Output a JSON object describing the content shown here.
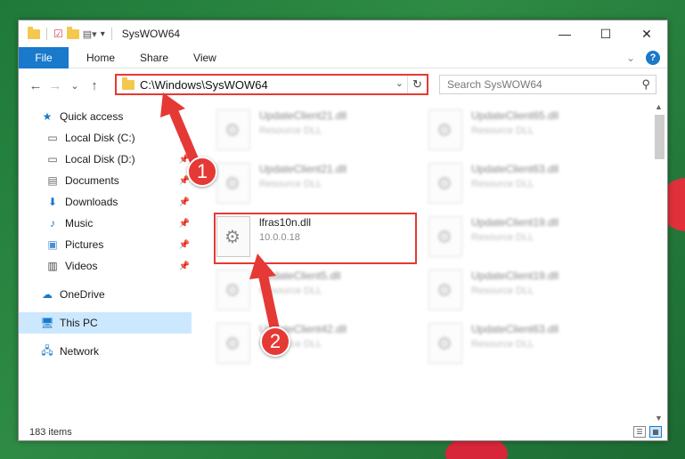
{
  "window": {
    "title": "SysWOW64"
  },
  "ribbon": {
    "file_label": "File",
    "tabs": [
      "Home",
      "Share",
      "View"
    ]
  },
  "navigation": {
    "back_label": "←",
    "forward_label": "→",
    "recent_label": "⌄",
    "up_label": "↑"
  },
  "address": {
    "path": "C:\\Windows\\SysWOW64"
  },
  "search": {
    "placeholder": "Search SysWOW64"
  },
  "sidebar": {
    "items": [
      {
        "label": "Quick access",
        "icon": "star-icon"
      },
      {
        "label": "Local Disk (C:)",
        "icon": "drive-icon"
      },
      {
        "label": "Local Disk (D:)",
        "icon": "drive-icon"
      },
      {
        "label": "Documents",
        "icon": "documents-icon"
      },
      {
        "label": "Downloads",
        "icon": "downloads-icon"
      },
      {
        "label": "Music",
        "icon": "music-icon"
      },
      {
        "label": "Pictures",
        "icon": "pictures-icon"
      },
      {
        "label": "Videos",
        "icon": "videos-icon"
      },
      {
        "label": "OneDrive",
        "icon": "cloud-icon"
      },
      {
        "label": "This PC",
        "icon": "computer-icon"
      },
      {
        "label": "Network",
        "icon": "network-icon"
      }
    ]
  },
  "files": {
    "left": [
      {
        "name": "UpdateClient21.dll",
        "sub": "Resource DLL"
      },
      {
        "name": "UpdateClient21.dll",
        "sub": "Resource DLL"
      },
      {
        "name": "lfras10n.dll",
        "sub": "10.0.0.18"
      },
      {
        "name": "UpdateClient5.dll",
        "sub": "Resource DLL"
      },
      {
        "name": "UpdateClient42.dll",
        "sub": "Resource DLL"
      }
    ],
    "right": [
      {
        "name": "UpdateClient65.dll",
        "sub": "Resource DLL"
      },
      {
        "name": "UpdateClient63.dll",
        "sub": "Resource DLL"
      },
      {
        "name": "UpdateClient19.dll",
        "sub": "Resource DLL"
      },
      {
        "name": "UpdateClient19.dll",
        "sub": "Resource DLL"
      },
      {
        "name": "UpdateClient63.dll",
        "sub": "Resource DLL"
      }
    ]
  },
  "status": {
    "items_count": "183 items"
  },
  "callouts": {
    "step1": "1",
    "step2": "2"
  },
  "colors": {
    "accent": "#1979ca",
    "highlight": "#e53935",
    "selection": "#cce8ff"
  }
}
